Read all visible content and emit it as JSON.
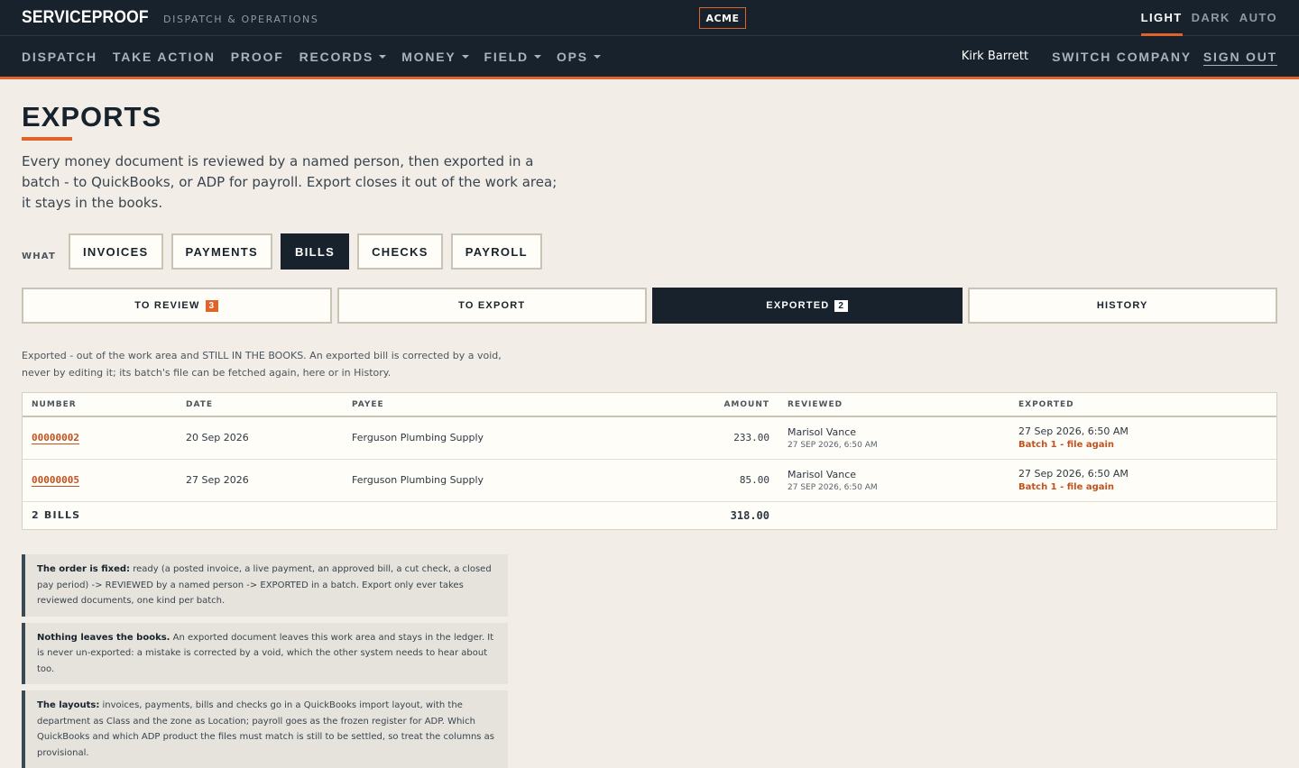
{
  "header": {
    "brand": "SERVICEPROOF",
    "brand_sub": "DISPATCH & OPERATIONS",
    "company": "ACME",
    "theme": [
      "LIGHT",
      "DARK",
      "AUTO"
    ]
  },
  "nav": {
    "items": [
      {
        "label": "DISPATCH",
        "dropdown": false
      },
      {
        "label": "TAKE ACTION",
        "dropdown": false
      },
      {
        "label": "PROOF",
        "dropdown": false
      },
      {
        "label": "RECORDS",
        "dropdown": true
      },
      {
        "label": "MONEY",
        "dropdown": true
      },
      {
        "label": "FIELD",
        "dropdown": true
      },
      {
        "label": "OPS",
        "dropdown": true
      }
    ],
    "user": "Kirk Barrett",
    "switch_company": "SWITCH COMPANY",
    "sign_out": "SIGN OUT"
  },
  "page": {
    "title": "EXPORTS",
    "intro": "Every money document is reviewed by a named person, then exported in a batch - to QuickBooks, or ADP for payroll. Export closes it out of the work area; it stays in the books.",
    "what_label": "WHAT",
    "doc_types": [
      "INVOICES",
      "PAYMENTS",
      "BILLS",
      "CHECKS",
      "PAYROLL"
    ],
    "stages": [
      {
        "label": "TO REVIEW",
        "count": "3"
      },
      {
        "label": "TO EXPORT",
        "count": ""
      },
      {
        "label": "EXPORTED",
        "count": "2"
      },
      {
        "label": "HISTORY",
        "count": ""
      }
    ],
    "stage_note": "Exported - out of the work area and STILL IN THE BOOKS. An exported bill is corrected by a void, never by editing it; its batch's file can be fetched again, here or in History."
  },
  "table": {
    "headers": {
      "number": "NUMBER",
      "date": "DATE",
      "payee": "PAYEE",
      "amount": "AMOUNT",
      "reviewed": "REVIEWED",
      "exported": "EXPORTED"
    },
    "rows": [
      {
        "number": "00000002",
        "date": "20 Sep 2026",
        "payee": "Ferguson Plumbing Supply",
        "amount": "233.00",
        "reviewer": "Marisol Vance",
        "reviewed_at": "27 SEP 2026, 6:50 AM",
        "exported_at": "27 Sep 2026, 6:50 AM",
        "batch": "Batch 1 - file again"
      },
      {
        "number": "00000005",
        "date": "27 Sep 2026",
        "payee": "Ferguson Plumbing Supply",
        "amount": "85.00",
        "reviewer": "Marisol Vance",
        "reviewed_at": "27 SEP 2026, 6:50 AM",
        "exported_at": "27 Sep 2026, 6:50 AM",
        "batch": "Batch 1 - file again"
      }
    ],
    "total_label": "2 BILLS",
    "total_amount": "318.00"
  },
  "notes": [
    {
      "title": "The order is fixed:",
      "body": " ready (a posted invoice, a live payment, an approved bill, a cut check, a closed pay period) -> REVIEWED by a named person -> EXPORTED in a batch. Export only ever takes reviewed documents, one kind per batch."
    },
    {
      "title": "Nothing leaves the books.",
      "body": " An exported document leaves this work area and stays in the ledger. It is never un-exported: a mistake is corrected by a void, which the other system needs to hear about too."
    },
    {
      "title": "The layouts:",
      "body": " invoices, payments, bills and checks go in a QuickBooks import layout, with the department as Class and the zone as Location; payroll goes as the frozen register for ADP. Which QuickBooks and which ADP product the files must match is still to be settled, so treat the columns as provisional."
    }
  ]
}
